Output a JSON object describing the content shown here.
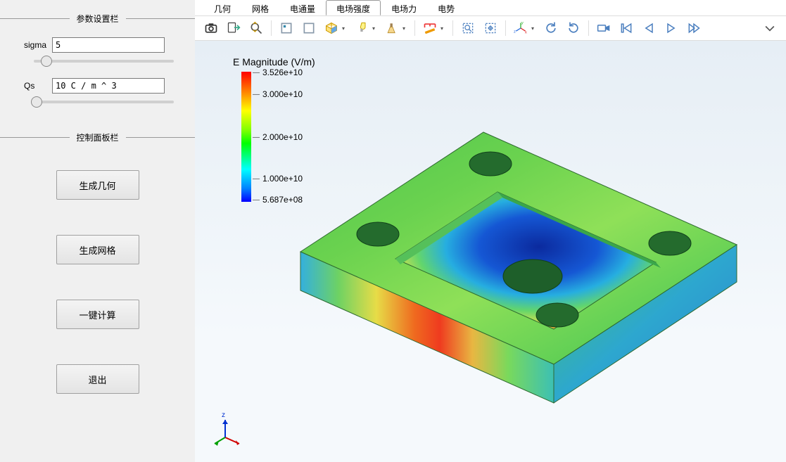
{
  "sidebar": {
    "params_title": "参数设置栏",
    "controls_title": "控制面板栏",
    "sigma_label": "sigma",
    "sigma_value": "5",
    "qs_label": "Qs",
    "qs_value": "10 C / m ^ 3",
    "buttons": {
      "generate_geometry": "生成几何",
      "generate_mesh": "生成网格",
      "one_click_calc": "一键计算",
      "exit": "退出"
    }
  },
  "tabs": [
    {
      "label": "几何"
    },
    {
      "label": "网格"
    },
    {
      "label": "电通量"
    },
    {
      "label": "电场强度",
      "active": true
    },
    {
      "label": "电场力"
    },
    {
      "label": "电势"
    }
  ],
  "legend": {
    "title": "E Magnitude (V/m)",
    "ticks": [
      {
        "label": "3.526e+10",
        "pos": 0
      },
      {
        "label": "3.000e+10",
        "pos": 17
      },
      {
        "label": "2.000e+10",
        "pos": 50
      },
      {
        "label": "1.000e+10",
        "pos": 82
      },
      {
        "label": "5.687e+08",
        "pos": 98
      }
    ]
  },
  "toolbar_icons": [
    "screenshot",
    "export",
    "zoom-reset",
    "box-a",
    "box-b",
    "iso-view",
    "lighting",
    "brush",
    "ruler",
    "select-rect",
    "select-move",
    "axis-preset",
    "rotate-ccw",
    "rotate-cw",
    "record",
    "skip-first",
    "prev-frame",
    "play",
    "next-frame"
  ]
}
